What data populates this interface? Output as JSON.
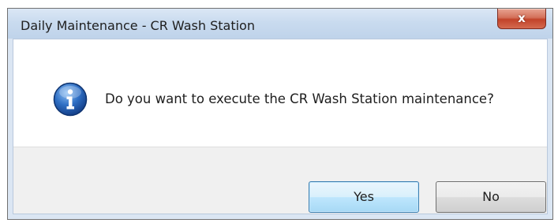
{
  "dialog": {
    "title": "Daily Maintenance - CR Wash Station",
    "close_label": "x",
    "message": "Do you want to execute the CR Wash Station maintenance?",
    "icon": "info-icon",
    "buttons": {
      "yes": "Yes",
      "no": "No"
    },
    "default_button": "yes"
  },
  "colors": {
    "titlebar": "#c9dbef",
    "close_button": "#c2432a",
    "button_bar": "#f0f0f0",
    "default_button_border": "#3c7fb1",
    "info_icon": "#2a62b8"
  }
}
